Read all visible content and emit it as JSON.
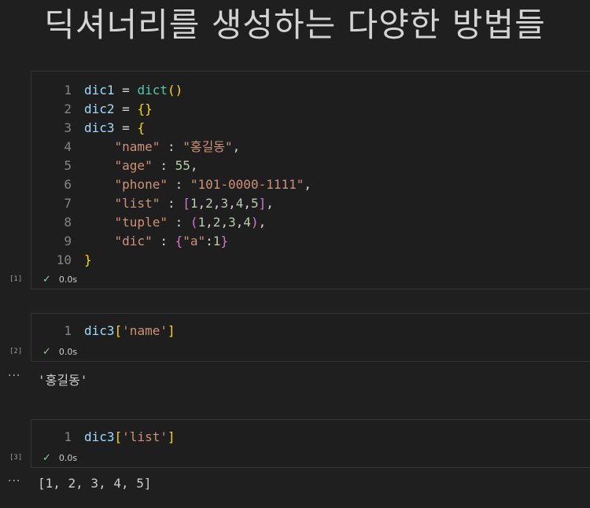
{
  "title": "딕셔너리를 생성하는 다양한 방법들",
  "status_check_icon": "check-icon",
  "cells": [
    {
      "exec_count": "[1]",
      "time": "0.0s",
      "lines": [
        {
          "num": "1",
          "tokens": [
            [
              "v",
              "dic1"
            ],
            [
              "o",
              " = "
            ],
            [
              "f",
              "dict"
            ],
            [
              "b1",
              "()"
            ]
          ]
        },
        {
          "num": "2",
          "tokens": [
            [
              "v",
              "dic2"
            ],
            [
              "o",
              " = "
            ],
            [
              "b1",
              "{}"
            ]
          ]
        },
        {
          "num": "3",
          "tokens": [
            [
              "v",
              "dic3"
            ],
            [
              "o",
              " = "
            ],
            [
              "b1",
              "{"
            ]
          ]
        },
        {
          "num": "4",
          "tokens": [
            [
              "o",
              "    "
            ],
            [
              "s",
              "\"name\""
            ],
            [
              "o",
              " : "
            ],
            [
              "s",
              "\"홍길동\""
            ],
            [
              "o",
              ","
            ]
          ]
        },
        {
          "num": "5",
          "tokens": [
            [
              "o",
              "    "
            ],
            [
              "s",
              "\"age\""
            ],
            [
              "o",
              " : "
            ],
            [
              "n",
              "55"
            ],
            [
              "o",
              ","
            ]
          ]
        },
        {
          "num": "6",
          "tokens": [
            [
              "o",
              "    "
            ],
            [
              "s",
              "\"phone\""
            ],
            [
              "o",
              " : "
            ],
            [
              "s",
              "\"101-0000-1111\""
            ],
            [
              "o",
              ","
            ]
          ]
        },
        {
          "num": "7",
          "tokens": [
            [
              "o",
              "    "
            ],
            [
              "s",
              "\"list\""
            ],
            [
              "o",
              " : "
            ],
            [
              "b2",
              "["
            ],
            [
              "n",
              "1"
            ],
            [
              "o",
              ","
            ],
            [
              "n",
              "2"
            ],
            [
              "o",
              ","
            ],
            [
              "n",
              "3"
            ],
            [
              "o",
              ","
            ],
            [
              "n",
              "4"
            ],
            [
              "o",
              ","
            ],
            [
              "n",
              "5"
            ],
            [
              "b2",
              "]"
            ],
            [
              "o",
              ","
            ]
          ]
        },
        {
          "num": "8",
          "tokens": [
            [
              "o",
              "    "
            ],
            [
              "s",
              "\"tuple\""
            ],
            [
              "o",
              " : "
            ],
            [
              "b2",
              "("
            ],
            [
              "n",
              "1"
            ],
            [
              "o",
              ","
            ],
            [
              "n",
              "2"
            ],
            [
              "o",
              ","
            ],
            [
              "n",
              "3"
            ],
            [
              "o",
              ","
            ],
            [
              "n",
              "4"
            ],
            [
              "b2",
              ")"
            ],
            [
              "o",
              ","
            ]
          ]
        },
        {
          "num": "9",
          "tokens": [
            [
              "o",
              "    "
            ],
            [
              "s",
              "\"dic\""
            ],
            [
              "o",
              " : "
            ],
            [
              "b2",
              "{"
            ],
            [
              "s",
              "\"a\""
            ],
            [
              "o",
              ":"
            ],
            [
              "n",
              "1"
            ],
            [
              "b2",
              "}"
            ]
          ]
        },
        {
          "num": "10",
          "tokens": [
            [
              "b1",
              "}"
            ]
          ]
        }
      ],
      "output": null
    },
    {
      "exec_count": "[2]",
      "time": "0.0s",
      "lines": [
        {
          "num": "1",
          "tokens": [
            [
              "v",
              "dic3"
            ],
            [
              "b1",
              "["
            ],
            [
              "s",
              "'name'"
            ],
            [
              "b1",
              "]"
            ]
          ]
        }
      ],
      "output": "'홍길동'"
    },
    {
      "exec_count": "[3]",
      "time": "0.0s",
      "lines": [
        {
          "num": "1",
          "tokens": [
            [
              "v",
              "dic3"
            ],
            [
              "b1",
              "["
            ],
            [
              "s",
              "'list'"
            ],
            [
              "b1",
              "]"
            ]
          ]
        }
      ],
      "output": "[1, 2, 3, 4, 5]"
    }
  ],
  "output_ellipsis": "···"
}
